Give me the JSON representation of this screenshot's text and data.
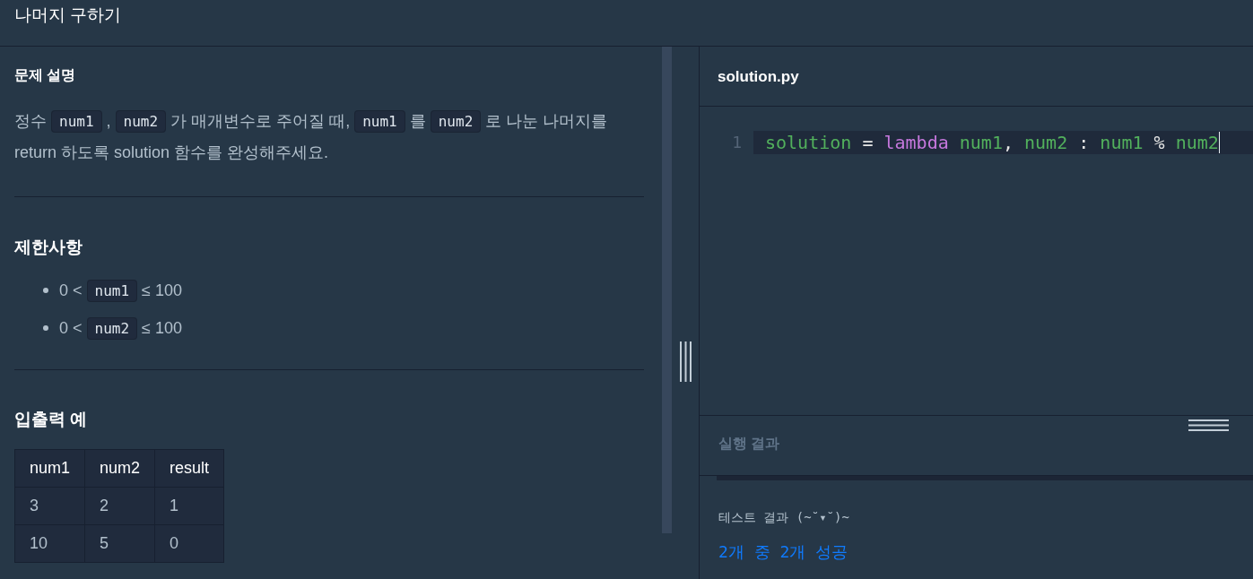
{
  "header": {
    "title": "나머지 구하기"
  },
  "description": {
    "heading": "문제 설명",
    "paragraph": [
      {
        "kind": "text",
        "text": "정수"
      },
      {
        "kind": "code",
        "text": "num1"
      },
      {
        "kind": "text",
        "text": ","
      },
      {
        "kind": "code",
        "text": "num2"
      },
      {
        "kind": "text",
        "text": "가 매개변수로 주어질 때,"
      },
      {
        "kind": "code",
        "text": "num1"
      },
      {
        "kind": "text",
        "text": "를"
      },
      {
        "kind": "code",
        "text": "num2"
      },
      {
        "kind": "text",
        "text": "로 나눈 나머지를 return 하도록 solution 함수를 완성해주세요."
      }
    ]
  },
  "constraints": {
    "heading": "제한사항",
    "items": [
      [
        {
          "kind": "text",
          "text": "0 <"
        },
        {
          "kind": "code",
          "text": "num1"
        },
        {
          "kind": "text",
          "text": "≤ 100"
        }
      ],
      [
        {
          "kind": "text",
          "text": "0 <"
        },
        {
          "kind": "code",
          "text": "num2"
        },
        {
          "kind": "text",
          "text": "≤ 100"
        }
      ]
    ]
  },
  "examples": {
    "heading": "입출력 예",
    "columns": [
      "num1",
      "num2",
      "result"
    ],
    "rows": [
      [
        "3",
        "2",
        "1"
      ],
      [
        "10",
        "5",
        "0"
      ]
    ]
  },
  "editor": {
    "filename": "solution.py",
    "lines": [
      {
        "number": "1",
        "cursor": true,
        "tokens": [
          {
            "kind": "name",
            "text": "solution"
          },
          {
            "kind": "operator",
            "text": "="
          },
          {
            "kind": "keyword",
            "text": "lambda"
          },
          {
            "kind": "name",
            "text": "num1"
          },
          {
            "kind": "punct",
            "text": ","
          },
          {
            "kind": "name",
            "text": "num2"
          },
          {
            "kind": "operator",
            "text": ":"
          },
          {
            "kind": "name",
            "text": "num1"
          },
          {
            "kind": "operator",
            "text": "%"
          },
          {
            "kind": "name",
            "text": "num2"
          }
        ]
      }
    ]
  },
  "results": {
    "title": "실행 결과",
    "heading": "테스트 결과 (~˘▾˘)~",
    "summary": "2개 중 2개 성공"
  }
}
